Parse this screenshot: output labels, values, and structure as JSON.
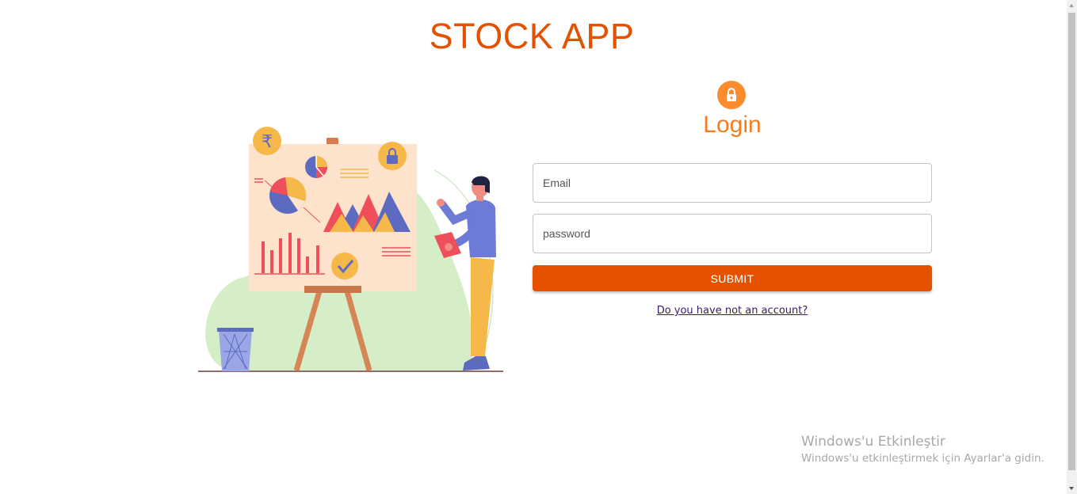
{
  "header": {
    "title": "STOCK APP"
  },
  "login": {
    "heading": "Login",
    "email": {
      "placeholder": "Email",
      "value": ""
    },
    "password": {
      "placeholder": "password",
      "value": ""
    },
    "submit_label": "SUBMIT",
    "register_link": "Do you have not an account?"
  },
  "icons": {
    "avatar": "lock-icon",
    "illustration": "presentation-illustration"
  },
  "colors": {
    "primary": "#e65100",
    "accent": "#f57c20",
    "link": "#3a1a6e"
  },
  "watermark": {
    "title": "Windows'u Etkinleştir",
    "subtitle": "Windows'u etkinleştirmek için Ayarlar'a gidin."
  }
}
